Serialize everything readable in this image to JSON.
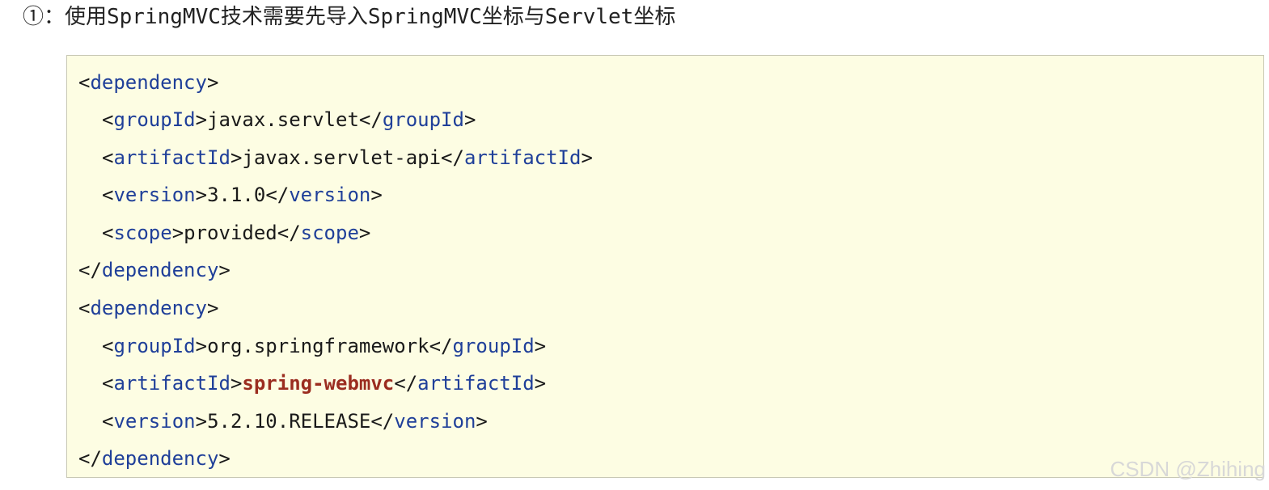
{
  "heading": "①：使用SpringMVC技术需要先导入SpringMVC坐标与Servlet坐标",
  "code": {
    "tags": {
      "dependency": "dependency",
      "groupId": "groupId",
      "artifactId": "artifactId",
      "version": "version",
      "scope": "scope"
    },
    "dep1": {
      "groupId": "javax.servlet",
      "artifactId": "javax.servlet-api",
      "version": "3.1.0",
      "scope": "provided"
    },
    "dep2": {
      "groupId": "org.springframework",
      "artifactId": "spring-webmvc",
      "version": "5.2.10.RELEASE"
    }
  },
  "colors": {
    "tag": "#1f3f99",
    "highlight": "#9b2d20",
    "code_background": "#fdfde3"
  },
  "watermark": "CSDN @Zhihing"
}
